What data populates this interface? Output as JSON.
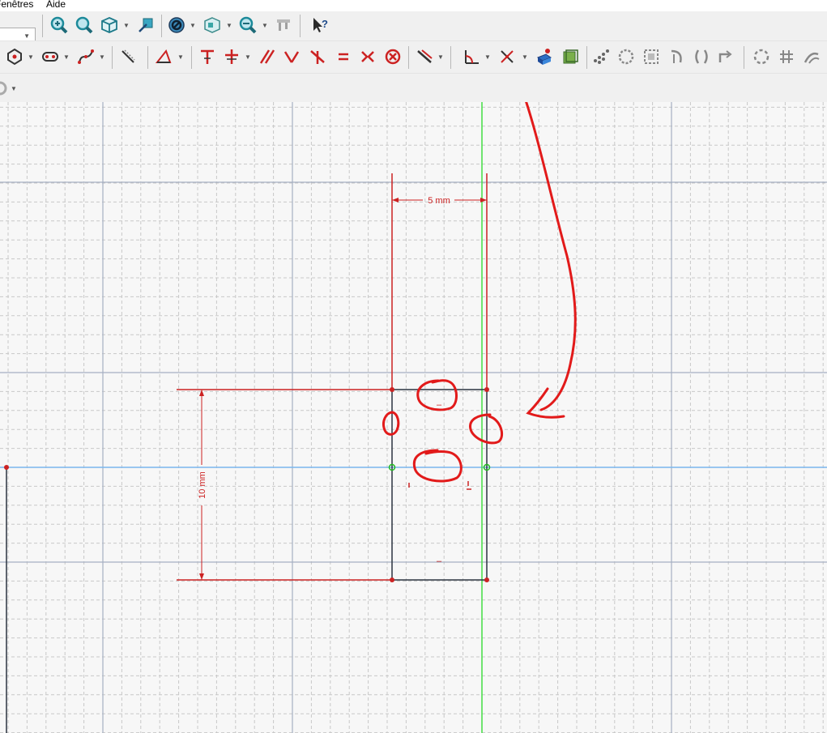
{
  "menubar": {
    "item_windows": "Fenêtres",
    "item_help": "Aide"
  },
  "toolbar1": {
    "icons": [
      "zoom-in-icon",
      "zoom-fit-icon",
      "view-cube-icon",
      "measure-icon",
      "stop-icon",
      "box-view-icon",
      "zoom-select-icon",
      "caliper-icon",
      "whats-this-icon"
    ]
  },
  "toolbar2": {
    "icons": [
      "polygon-icon",
      "slot-icon",
      "bspline-icon",
      "external-geometry-icon",
      "carbon-copy-icon",
      "trim-icon",
      "split-icon",
      "horizontal-constraint-icon",
      "parallel-constraint-icon",
      "perpendicular-constraint-icon",
      "tangent-constraint-icon",
      "equal-constraint-icon",
      "symmetric-constraint-icon",
      "block-constraint-icon",
      "dimension-icon",
      "angle-constraint-icon",
      "toggle-construction-icon",
      "validate-sketch-icon",
      "merge-sketch-icon",
      "array-icon",
      "mirror-icon"
    ]
  },
  "sketch": {
    "dim_horizontal": "5 mm",
    "dim_vertical": "10 mm",
    "constraint_mark": "–"
  },
  "colors": {
    "constraint_red": "#cc2222",
    "grid_minor": "#c8c8c8",
    "grid_major": "#a6b0c2",
    "axis_x": "#7ab6ee",
    "axis_y": "#44dd44",
    "geometry": "#2c3440",
    "annotation_red": "#e21a1a"
  }
}
